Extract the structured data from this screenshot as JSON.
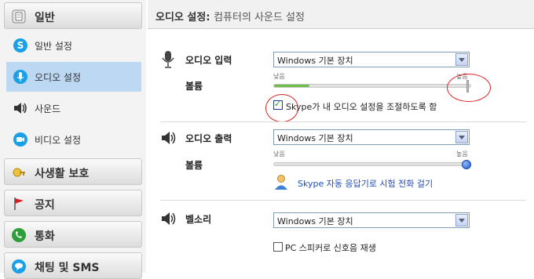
{
  "sidebar": {
    "general": {
      "label": "일반",
      "icon": "gear-icon"
    },
    "general_items": [
      {
        "label": "일반 설정",
        "icon": "skype-icon"
      },
      {
        "label": "오디오 설정",
        "icon": "microphone-icon",
        "active": true
      },
      {
        "label": "사운드",
        "icon": "speaker-icon"
      },
      {
        "label": "비디오 설정",
        "icon": "video-icon"
      }
    ],
    "privacy": {
      "label": "사생활 보호",
      "icon": "lock-icon"
    },
    "notices": {
      "label": "공지",
      "icon": "flag-icon"
    },
    "calls": {
      "label": "통화",
      "icon": "phone-icon"
    },
    "chat": {
      "label": "채팅 및 SMS",
      "icon": "chat-icon"
    }
  },
  "header": {
    "title": "오디오 설정:",
    "subtitle": "컴퓨터의 사운드 설정"
  },
  "audio_input": {
    "label": "오디오 입력",
    "device": "Windows 기본 장치",
    "volume_label": "볼륨",
    "low_label": "낮음",
    "high_label": "높음",
    "level": 0.18,
    "auto_adjust_label": "Skype가 내 오디오 설정을 조절하도록 함",
    "auto_adjust_checked": true
  },
  "audio_output": {
    "label": "오디오 출력",
    "device": "Windows 기본 장치",
    "volume_label": "볼륨",
    "low_label": "낮음",
    "high_label": "높음",
    "level": 1.0,
    "test_call_link": "Skype 자동 응답기로 시험 전화 걸기"
  },
  "ringing": {
    "label": "벨소리",
    "device": "Windows 기본 장치",
    "pc_speaker_label": "PC 스피커로 신호음 재생",
    "pc_speaker_checked": false
  },
  "colors": {
    "accent_blue": "#1f4db8",
    "active_item": "#bcd8f3",
    "annotation_red": "#d22222",
    "level_green": "#6cc04a"
  }
}
